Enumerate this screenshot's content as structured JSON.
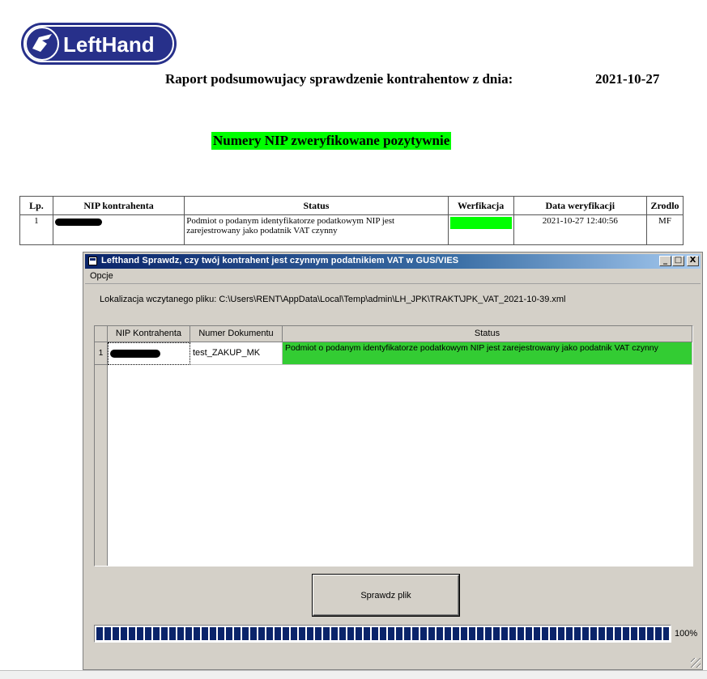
{
  "report": {
    "logo_text": "LeftHand",
    "title": "Raport podsumowujacy sprawdzenie kontrahentow z dnia:",
    "date": "2021-10-27",
    "section_title": "Numery NIP zweryfikowane pozytywnie",
    "columns": [
      "Lp.",
      "NIP kontrahenta",
      "Status",
      "Werfikacja",
      "Data weryfikacji",
      "Zrodlo"
    ],
    "rows": [
      {
        "lp": "1",
        "status": "Podmiot o podanym identyfikatorze podatkowym NIP jest zarejestrowany jako podatnik VAT czynny",
        "verification_date": "2021-10-27 12:40:56",
        "source": "MF",
        "verified_color": "#00ff00"
      }
    ]
  },
  "window": {
    "title": "Lefthand Sprawdz, czy twój kontrahent jest czynnym podatnikiem VAT w GUS/VIES",
    "buttons": {
      "minimize": "_",
      "maximize": "□",
      "close": "X"
    },
    "menu": [
      "Opcje"
    ],
    "file_label": "Lokalizacja wczytanego pliku: C:\\Users\\RENT\\AppData\\Local\\Temp\\admin\\LH_JPK\\TRAKT\\JPK_VAT_2021-10-39.xml",
    "grid": {
      "columns": [
        "NIP Kontrahenta",
        "Numer Dokumentu",
        "Status"
      ],
      "rows": [
        {
          "row_num": "1",
          "document": "test_ZAKUP_MK",
          "status": "Podmiot  o  podanym identyfikatorze  podatkowym  NIP  jest zarejestrowany jako podatnik VAT czynny",
          "status_color": "#33cc33"
        }
      ]
    },
    "check_button": "Sprawdz plik",
    "progress": {
      "value": 1.0,
      "label": "100%"
    }
  }
}
